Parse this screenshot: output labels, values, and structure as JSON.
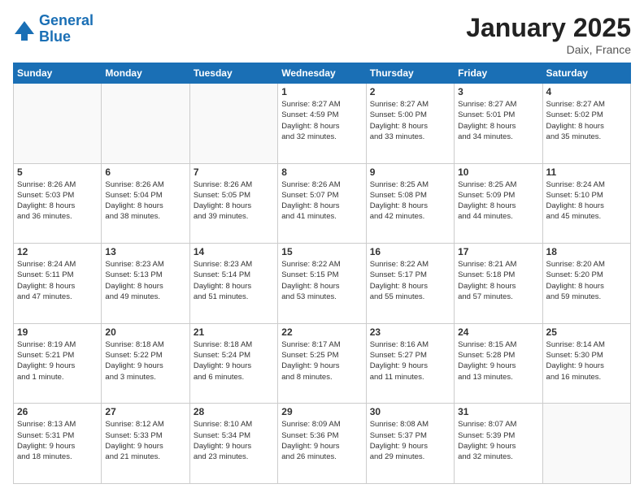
{
  "logo": {
    "line1": "General",
    "line2": "Blue"
  },
  "header": {
    "month": "January 2025",
    "location": "Daix, France"
  },
  "weekdays": [
    "Sunday",
    "Monday",
    "Tuesday",
    "Wednesday",
    "Thursday",
    "Friday",
    "Saturday"
  ],
  "weeks": [
    [
      {
        "day": "",
        "info": ""
      },
      {
        "day": "",
        "info": ""
      },
      {
        "day": "",
        "info": ""
      },
      {
        "day": "1",
        "info": "Sunrise: 8:27 AM\nSunset: 4:59 PM\nDaylight: 8 hours\nand 32 minutes."
      },
      {
        "day": "2",
        "info": "Sunrise: 8:27 AM\nSunset: 5:00 PM\nDaylight: 8 hours\nand 33 minutes."
      },
      {
        "day": "3",
        "info": "Sunrise: 8:27 AM\nSunset: 5:01 PM\nDaylight: 8 hours\nand 34 minutes."
      },
      {
        "day": "4",
        "info": "Sunrise: 8:27 AM\nSunset: 5:02 PM\nDaylight: 8 hours\nand 35 minutes."
      }
    ],
    [
      {
        "day": "5",
        "info": "Sunrise: 8:26 AM\nSunset: 5:03 PM\nDaylight: 8 hours\nand 36 minutes."
      },
      {
        "day": "6",
        "info": "Sunrise: 8:26 AM\nSunset: 5:04 PM\nDaylight: 8 hours\nand 38 minutes."
      },
      {
        "day": "7",
        "info": "Sunrise: 8:26 AM\nSunset: 5:05 PM\nDaylight: 8 hours\nand 39 minutes."
      },
      {
        "day": "8",
        "info": "Sunrise: 8:26 AM\nSunset: 5:07 PM\nDaylight: 8 hours\nand 41 minutes."
      },
      {
        "day": "9",
        "info": "Sunrise: 8:25 AM\nSunset: 5:08 PM\nDaylight: 8 hours\nand 42 minutes."
      },
      {
        "day": "10",
        "info": "Sunrise: 8:25 AM\nSunset: 5:09 PM\nDaylight: 8 hours\nand 44 minutes."
      },
      {
        "day": "11",
        "info": "Sunrise: 8:24 AM\nSunset: 5:10 PM\nDaylight: 8 hours\nand 45 minutes."
      }
    ],
    [
      {
        "day": "12",
        "info": "Sunrise: 8:24 AM\nSunset: 5:11 PM\nDaylight: 8 hours\nand 47 minutes."
      },
      {
        "day": "13",
        "info": "Sunrise: 8:23 AM\nSunset: 5:13 PM\nDaylight: 8 hours\nand 49 minutes."
      },
      {
        "day": "14",
        "info": "Sunrise: 8:23 AM\nSunset: 5:14 PM\nDaylight: 8 hours\nand 51 minutes."
      },
      {
        "day": "15",
        "info": "Sunrise: 8:22 AM\nSunset: 5:15 PM\nDaylight: 8 hours\nand 53 minutes."
      },
      {
        "day": "16",
        "info": "Sunrise: 8:22 AM\nSunset: 5:17 PM\nDaylight: 8 hours\nand 55 minutes."
      },
      {
        "day": "17",
        "info": "Sunrise: 8:21 AM\nSunset: 5:18 PM\nDaylight: 8 hours\nand 57 minutes."
      },
      {
        "day": "18",
        "info": "Sunrise: 8:20 AM\nSunset: 5:20 PM\nDaylight: 8 hours\nand 59 minutes."
      }
    ],
    [
      {
        "day": "19",
        "info": "Sunrise: 8:19 AM\nSunset: 5:21 PM\nDaylight: 9 hours\nand 1 minute."
      },
      {
        "day": "20",
        "info": "Sunrise: 8:18 AM\nSunset: 5:22 PM\nDaylight: 9 hours\nand 3 minutes."
      },
      {
        "day": "21",
        "info": "Sunrise: 8:18 AM\nSunset: 5:24 PM\nDaylight: 9 hours\nand 6 minutes."
      },
      {
        "day": "22",
        "info": "Sunrise: 8:17 AM\nSunset: 5:25 PM\nDaylight: 9 hours\nand 8 minutes."
      },
      {
        "day": "23",
        "info": "Sunrise: 8:16 AM\nSunset: 5:27 PM\nDaylight: 9 hours\nand 11 minutes."
      },
      {
        "day": "24",
        "info": "Sunrise: 8:15 AM\nSunset: 5:28 PM\nDaylight: 9 hours\nand 13 minutes."
      },
      {
        "day": "25",
        "info": "Sunrise: 8:14 AM\nSunset: 5:30 PM\nDaylight: 9 hours\nand 16 minutes."
      }
    ],
    [
      {
        "day": "26",
        "info": "Sunrise: 8:13 AM\nSunset: 5:31 PM\nDaylight: 9 hours\nand 18 minutes."
      },
      {
        "day": "27",
        "info": "Sunrise: 8:12 AM\nSunset: 5:33 PM\nDaylight: 9 hours\nand 21 minutes."
      },
      {
        "day": "28",
        "info": "Sunrise: 8:10 AM\nSunset: 5:34 PM\nDaylight: 9 hours\nand 23 minutes."
      },
      {
        "day": "29",
        "info": "Sunrise: 8:09 AM\nSunset: 5:36 PM\nDaylight: 9 hours\nand 26 minutes."
      },
      {
        "day": "30",
        "info": "Sunrise: 8:08 AM\nSunset: 5:37 PM\nDaylight: 9 hours\nand 29 minutes."
      },
      {
        "day": "31",
        "info": "Sunrise: 8:07 AM\nSunset: 5:39 PM\nDaylight: 9 hours\nand 32 minutes."
      },
      {
        "day": "",
        "info": ""
      }
    ]
  ]
}
